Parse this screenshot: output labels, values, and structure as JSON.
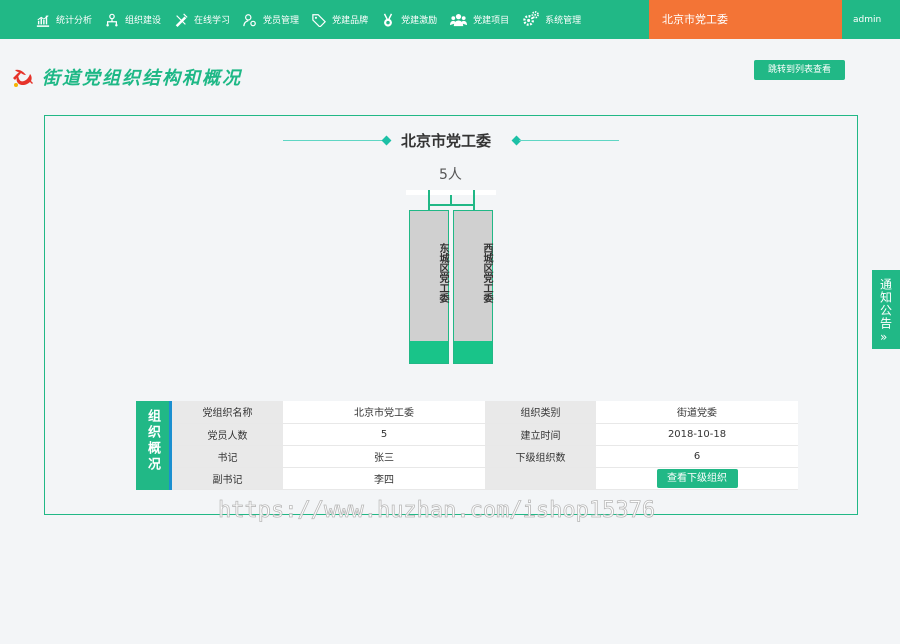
{
  "nav": {
    "items": [
      {
        "label": "统计分析",
        "icon": "bar-chart-icon"
      },
      {
        "label": "组织建设",
        "icon": "org-tree-icon"
      },
      {
        "label": "在线学习",
        "icon": "pen-tool-icon"
      },
      {
        "label": "党员管理",
        "icon": "user-gear-icon"
      },
      {
        "label": "党建品牌",
        "icon": "tag-icon"
      },
      {
        "label": "党建激励",
        "icon": "medal-icon"
      },
      {
        "label": "党建项目",
        "icon": "group-icon"
      },
      {
        "label": "系统管理",
        "icon": "gears-icon"
      }
    ],
    "org_tab": "北京市党工委",
    "user": "admin"
  },
  "page": {
    "title": "街道党组织结构和概况",
    "jump_button": "跳转到列表查看"
  },
  "structure": {
    "org_name": "北京市党工委",
    "member_count": "5人",
    "children": [
      "东城区党工委",
      "西城区党工委"
    ]
  },
  "overview": {
    "side_label": "组织概况",
    "rows": [
      {
        "l1": "党组织名称",
        "v1": "北京市党工委",
        "l2": "组织类别",
        "v2": "街道党委"
      },
      {
        "l1": "党员人数",
        "v1": "5",
        "l2": "建立时间",
        "v2": "2018-10-18"
      },
      {
        "l1": "书记",
        "v1": "张三",
        "l2": "下级组织数",
        "v2": "6"
      },
      {
        "l1": "副书记",
        "v1": "李四",
        "l2": "",
        "v2": ""
      }
    ],
    "sub_button": "查看下级组织"
  },
  "notice": {
    "label": "通知公告",
    "arrow": "»"
  },
  "watermark": "https://www.huzhan.com/ishop15376",
  "colors": {
    "primary": "#21b886",
    "accent": "#f37436",
    "node_fill": "#d0d0d0"
  }
}
